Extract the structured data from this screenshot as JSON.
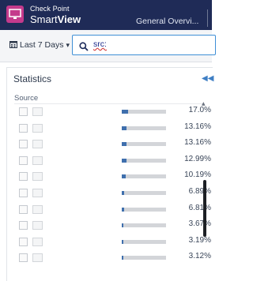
{
  "header": {
    "brand_top": "Check Point",
    "brand_main_prefix": "Smart",
    "brand_main_suffix": "View",
    "tab_title": "General Overvi..."
  },
  "toolbar": {
    "timerange_label": "Last 7 Days",
    "search_value": "src:"
  },
  "panel": {
    "title": "Statistics",
    "section_label": "Source"
  },
  "rows": [
    {
      "pct_label": "17.0%",
      "share": 0.17
    },
    {
      "pct_label": "13.16%",
      "share": 0.1316
    },
    {
      "pct_label": "13.16%",
      "share": 0.1316
    },
    {
      "pct_label": "12.99%",
      "share": 0.1299
    },
    {
      "pct_label": "10.19%",
      "share": 0.1019
    },
    {
      "pct_label": "6.89%",
      "share": 0.0689
    },
    {
      "pct_label": "6.81%",
      "share": 0.0681
    },
    {
      "pct_label": "3.67%",
      "share": 0.0367
    },
    {
      "pct_label": "3.19%",
      "share": 0.0319
    },
    {
      "pct_label": "3.12%",
      "share": 0.0312
    }
  ],
  "colors": {
    "header_bg": "#1f2b57",
    "logo_accent": "#c43a8c",
    "bar_fill": "#3f6fad",
    "bar_track": "#d3d5d9",
    "search_border": "#3f8fd6"
  },
  "icons": {
    "logo": "monitor-logo-icon",
    "calendar": "calendar-icon",
    "search": "search-icon",
    "collapse": "double-chevron-left-icon"
  }
}
